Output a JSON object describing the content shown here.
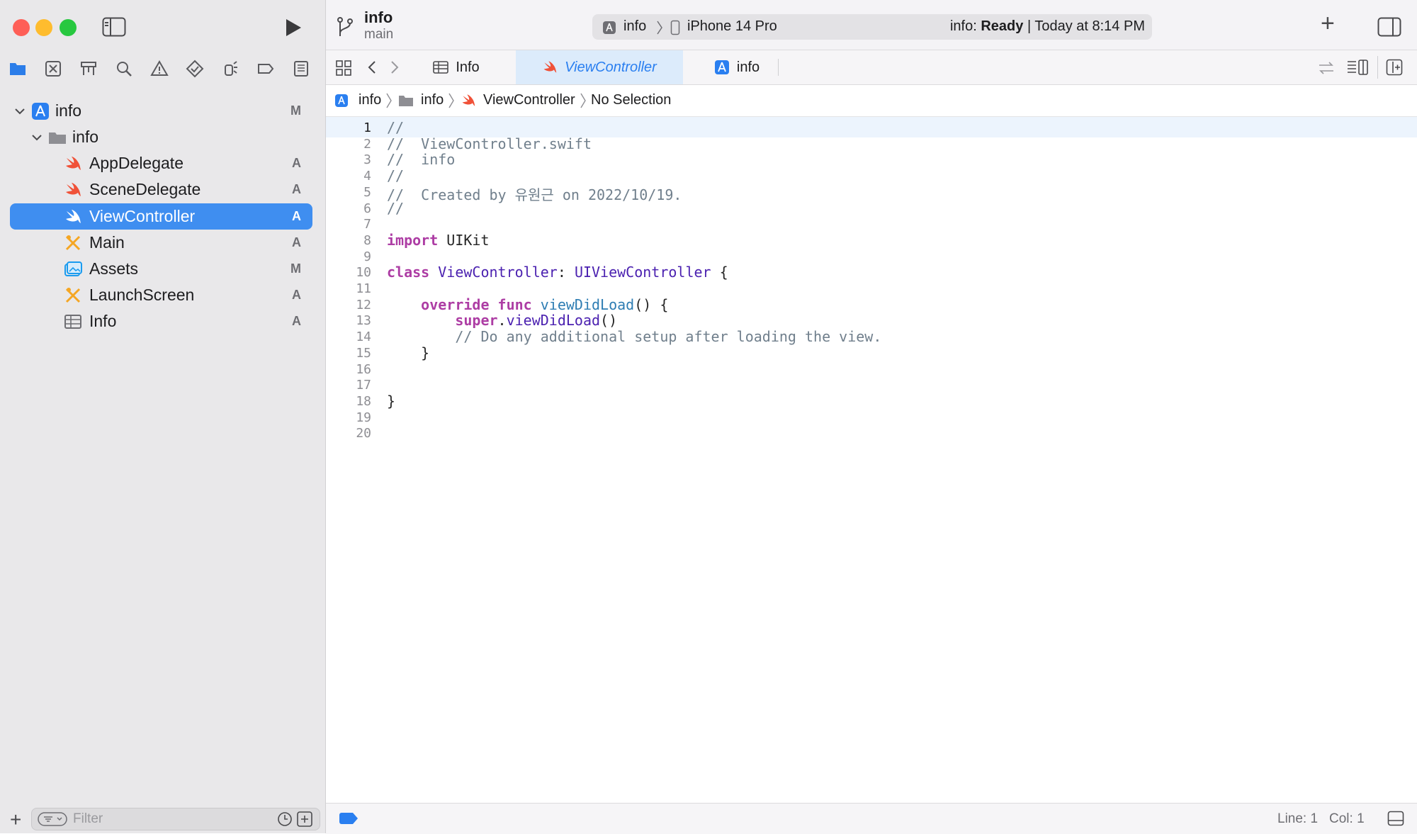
{
  "window": {
    "traffic_lights": {
      "close": "#fe5f57",
      "minimize": "#febc2e",
      "zoom": "#28c840"
    }
  },
  "toolbar": {
    "project_name": "info",
    "branch": "main",
    "scheme_target": "info",
    "device": "iPhone 14 Pro",
    "status_prefix": "info:",
    "status_state": "Ready",
    "status_separator": "|",
    "status_time": "Today at 8:14 PM",
    "add_label": "+"
  },
  "navigator": {
    "tree": [
      {
        "label": "info",
        "status": "M",
        "icon": "app-project-icon"
      },
      {
        "label": "info",
        "status": "",
        "icon": "folder-icon"
      },
      {
        "label": "AppDelegate",
        "status": "A",
        "icon": "swift-icon"
      },
      {
        "label": "SceneDelegate",
        "status": "A",
        "icon": "swift-icon"
      },
      {
        "label": "ViewController",
        "status": "A",
        "icon": "swift-icon",
        "selected": true
      },
      {
        "label": "Main",
        "status": "A",
        "icon": "storyboard-icon"
      },
      {
        "label": "Assets",
        "status": "M",
        "icon": "assets-icon"
      },
      {
        "label": "LaunchScreen",
        "status": "A",
        "icon": "storyboard-icon"
      },
      {
        "label": "Info",
        "status": "A",
        "icon": "plist-icon"
      }
    ],
    "filter_placeholder": "Filter",
    "add_label": "+"
  },
  "tabs": [
    {
      "label": "Info",
      "icon": "plist-icon"
    },
    {
      "label": "ViewController",
      "icon": "swift-icon",
      "active": true
    },
    {
      "label": "info",
      "icon": "app-project-icon"
    }
  ],
  "jumpbar": {
    "items": [
      "info",
      "info",
      "ViewController",
      "No Selection"
    ]
  },
  "editor": {
    "current_line": 1,
    "lines": [
      {
        "n": "1",
        "parts": [
          [
            "cm",
            "//"
          ]
        ]
      },
      {
        "n": "2",
        "parts": [
          [
            "cm",
            "//  ViewController.swift"
          ]
        ]
      },
      {
        "n": "3",
        "parts": [
          [
            "cm",
            "//  info"
          ]
        ]
      },
      {
        "n": "4",
        "parts": [
          [
            "cm",
            "//"
          ]
        ]
      },
      {
        "n": "5",
        "parts": [
          [
            "cm",
            "//  Created by 유원근 on 2022/10/19."
          ]
        ]
      },
      {
        "n": "6",
        "parts": [
          [
            "cm",
            "//"
          ]
        ]
      },
      {
        "n": "7",
        "parts": []
      },
      {
        "n": "8",
        "parts": [
          [
            "kw",
            "import"
          ],
          [
            "pl",
            " UIKit"
          ]
        ]
      },
      {
        "n": "9",
        "parts": []
      },
      {
        "n": "10",
        "parts": [
          [
            "kw",
            "class"
          ],
          [
            "pl",
            " "
          ],
          [
            "ty",
            "ViewController"
          ],
          [
            "pl",
            ": "
          ],
          [
            "ty",
            "UIViewController"
          ],
          [
            "pl",
            " {"
          ]
        ]
      },
      {
        "n": "11",
        "parts": []
      },
      {
        "n": "12",
        "parts": [
          [
            "pl",
            "    "
          ],
          [
            "kw",
            "override"
          ],
          [
            "pl",
            " "
          ],
          [
            "kw",
            "func"
          ],
          [
            "pl",
            " "
          ],
          [
            "fn",
            "viewDidLoad"
          ],
          [
            "pl",
            "() {"
          ]
        ]
      },
      {
        "n": "13",
        "parts": [
          [
            "pl",
            "        "
          ],
          [
            "kw",
            "super"
          ],
          [
            "pl",
            "."
          ],
          [
            "ty",
            "viewDidLoad"
          ],
          [
            "pl",
            "()"
          ]
        ]
      },
      {
        "n": "14",
        "parts": [
          [
            "pl",
            "        "
          ],
          [
            "cm",
            "// Do any additional setup after loading the view."
          ]
        ]
      },
      {
        "n": "15",
        "parts": [
          [
            "pl",
            "    }"
          ]
        ]
      },
      {
        "n": "16",
        "parts": []
      },
      {
        "n": "17",
        "parts": []
      },
      {
        "n": "18",
        "parts": [
          [
            "pl",
            "}"
          ]
        ]
      },
      {
        "n": "19",
        "parts": []
      },
      {
        "n": "20",
        "parts": []
      }
    ]
  },
  "statusbar": {
    "line_label": "Line: 1",
    "col_label": "Col: 1"
  },
  "colors": {
    "accent": "#3f8ef0",
    "swift": "#f05138",
    "keyword": "#ad3da4",
    "type": "#4b21b0",
    "function": "#2e7db3",
    "comment": "#707f8c"
  }
}
